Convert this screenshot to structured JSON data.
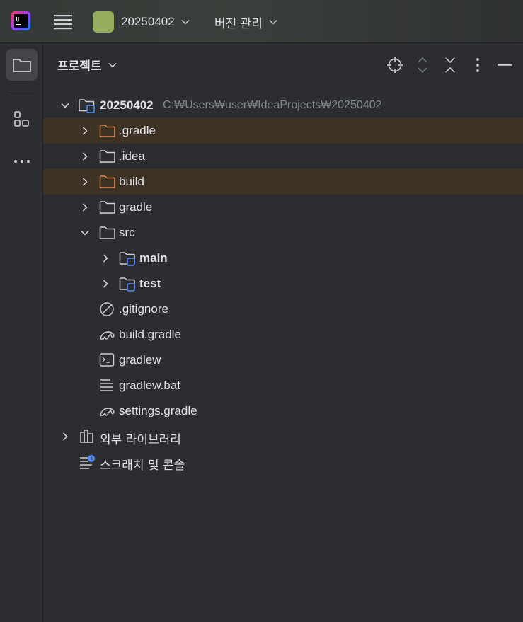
{
  "titlebar": {
    "app_logo": "intellij-idea-logo",
    "menu_icon": "hamburger-menu-icon",
    "project_name": "20250402",
    "project_badge_color": "#97ad5e",
    "vcs_label": "버전 관리"
  },
  "toolstrip": {
    "items": [
      {
        "icon": "folder-icon",
        "active": true
      },
      {
        "icon": "structure-icon",
        "active": false
      },
      {
        "icon": "more-horizontal-icon",
        "active": false
      }
    ]
  },
  "panel": {
    "title": "프로젝트",
    "header_icons": [
      "locate-icon",
      "expand-all-icon",
      "collapse-all-icon",
      "more-vertical-icon",
      "hide-icon"
    ]
  },
  "tree": {
    "root_name": "20250402",
    "root_path": "C:₩Users₩user₩IdeaProjects₩20250402",
    "items": [
      {
        "name": ".gradle",
        "type": "folder-excluded"
      },
      {
        "name": ".idea",
        "type": "folder"
      },
      {
        "name": "build",
        "type": "folder-excluded"
      },
      {
        "name": "gradle",
        "type": "folder"
      },
      {
        "name": "src",
        "type": "folder",
        "expanded": true
      },
      {
        "name": "main",
        "type": "module-folder"
      },
      {
        "name": "test",
        "type": "module-folder"
      },
      {
        "name": ".gitignore",
        "type": "ignore-file"
      },
      {
        "name": "build.gradle",
        "type": "gradle-file"
      },
      {
        "name": "gradlew",
        "type": "shell-file"
      },
      {
        "name": "gradlew.bat",
        "type": "text-file"
      },
      {
        "name": "settings.gradle",
        "type": "gradle-file"
      }
    ],
    "external_libraries": "외부 라이브러리",
    "scratches": "스크래치 및 콘솔"
  },
  "colors": {
    "background": "#2b2d30",
    "excluded_row": "#3d3223",
    "excluded_folder": "#e08855",
    "module_blue": "#548af7",
    "text": "#dfe1e5",
    "muted_text": "#868a91"
  }
}
